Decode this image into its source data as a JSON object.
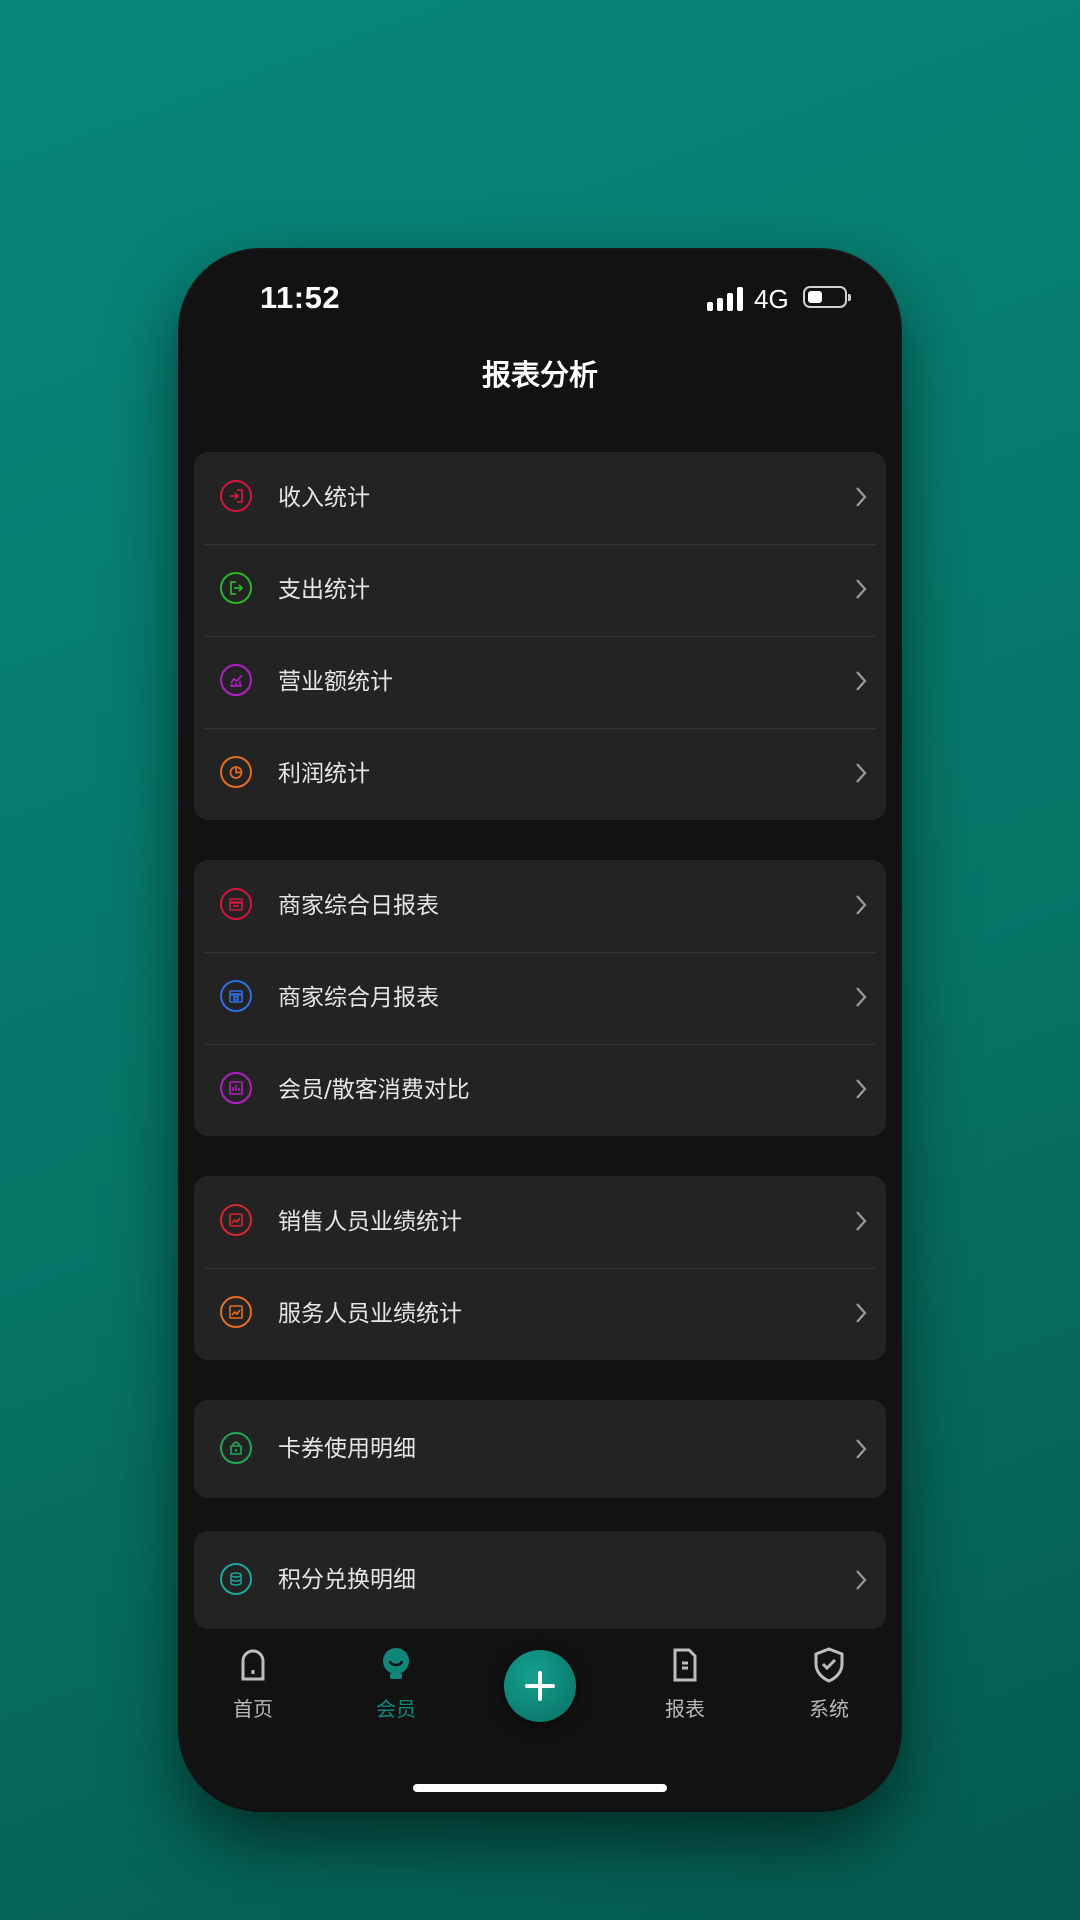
{
  "status_bar": {
    "time": "11:52",
    "network": "4G"
  },
  "header": {
    "title": "报表分析"
  },
  "groups": [
    {
      "items": [
        {
          "label": "收入统计",
          "icon": "income-icon",
          "color": "#d4163f"
        },
        {
          "label": "支出统计",
          "icon": "expense-icon",
          "color": "#2bb52f"
        },
        {
          "label": "营业额统计",
          "icon": "turnover-icon",
          "color": "#b31fc4"
        },
        {
          "label": "利润统计",
          "icon": "profit-icon",
          "color": "#e46d1e"
        }
      ]
    },
    {
      "items": [
        {
          "label": "商家综合日报表",
          "icon": "daily-report-icon",
          "color": "#d4163f"
        },
        {
          "label": "商家综合月报表",
          "icon": "monthly-report-icon",
          "color": "#2f6ee0"
        },
        {
          "label": "会员/散客消费对比",
          "icon": "comparison-icon",
          "color": "#b31fc4"
        }
      ]
    },
    {
      "items": [
        {
          "label": "销售人员业绩统计",
          "icon": "sales-performance-icon",
          "color": "#d9262f"
        },
        {
          "label": "服务人员业绩统计",
          "icon": "service-performance-icon",
          "color": "#e46d1e"
        }
      ]
    },
    {
      "items": [
        {
          "label": "卡券使用明细",
          "icon": "coupon-icon",
          "color": "#1ea85b"
        }
      ]
    },
    {
      "items": [
        {
          "label": "积分兑换明细",
          "icon": "points-icon",
          "color": "#1aa89a"
        }
      ]
    }
  ],
  "tabbar": {
    "items": [
      {
        "label": "首页",
        "icon": "home-icon"
      },
      {
        "label": "会员",
        "icon": "member-icon",
        "active": true
      },
      {
        "label": "报表",
        "icon": "report-icon"
      },
      {
        "label": "系统",
        "icon": "system-icon"
      }
    ],
    "center_button_icon": "plus-icon",
    "accent_color": "#11877a"
  }
}
